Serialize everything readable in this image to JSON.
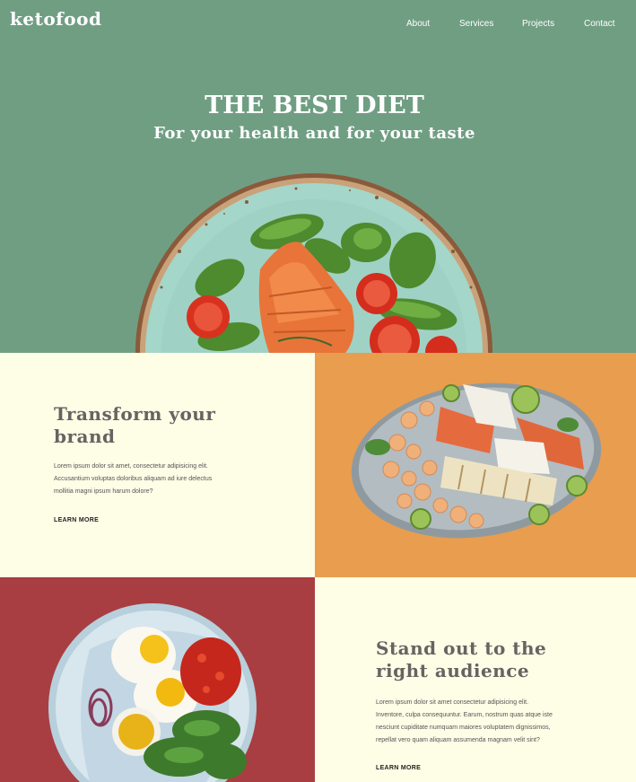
{
  "header": {
    "logo": "ketofood",
    "nav": [
      "About",
      "Services",
      "Projects",
      "Contact"
    ]
  },
  "hero": {
    "title": "THE BEST DIET",
    "subtitle": "For your health and for your taste"
  },
  "section1": {
    "heading_line1": "Transform your",
    "heading_line2": "brand",
    "text_lines": [
      "Lorem ipsum dolor sit amet, consectetur adipisicing elit.",
      "Accusantium voluptas doloribus aliquam ad iure delectus",
      "mollitia magni ipsum harum dolore?"
    ],
    "cta": "LEARN MORE"
  },
  "section2": {
    "heading_line1": "Stand out to the",
    "heading_line2": "right audience",
    "text_lines": [
      "Lorem ipsum dolor sit amet consectetur adipisicing elit.",
      "Inventore, culpa consequuntur. Earum, nostrum quas atque iste",
      "nesciunt cupiditate numquam maiores voluptatem dignissimos,",
      "repellat vero quam aliquam assumenda magnam velit sint?"
    ],
    "cta": "LEARN MORE"
  },
  "colors": {
    "hero_bg": "#709e83",
    "cream_bg": "#fefde6",
    "orange_bg": "#e99d4f",
    "red_bg": "#a83e41",
    "heading": "#666462"
  },
  "icons": [
    "salmon-salad-plate-image",
    "seafood-platter-image",
    "egg-breakfast-plate-image"
  ]
}
